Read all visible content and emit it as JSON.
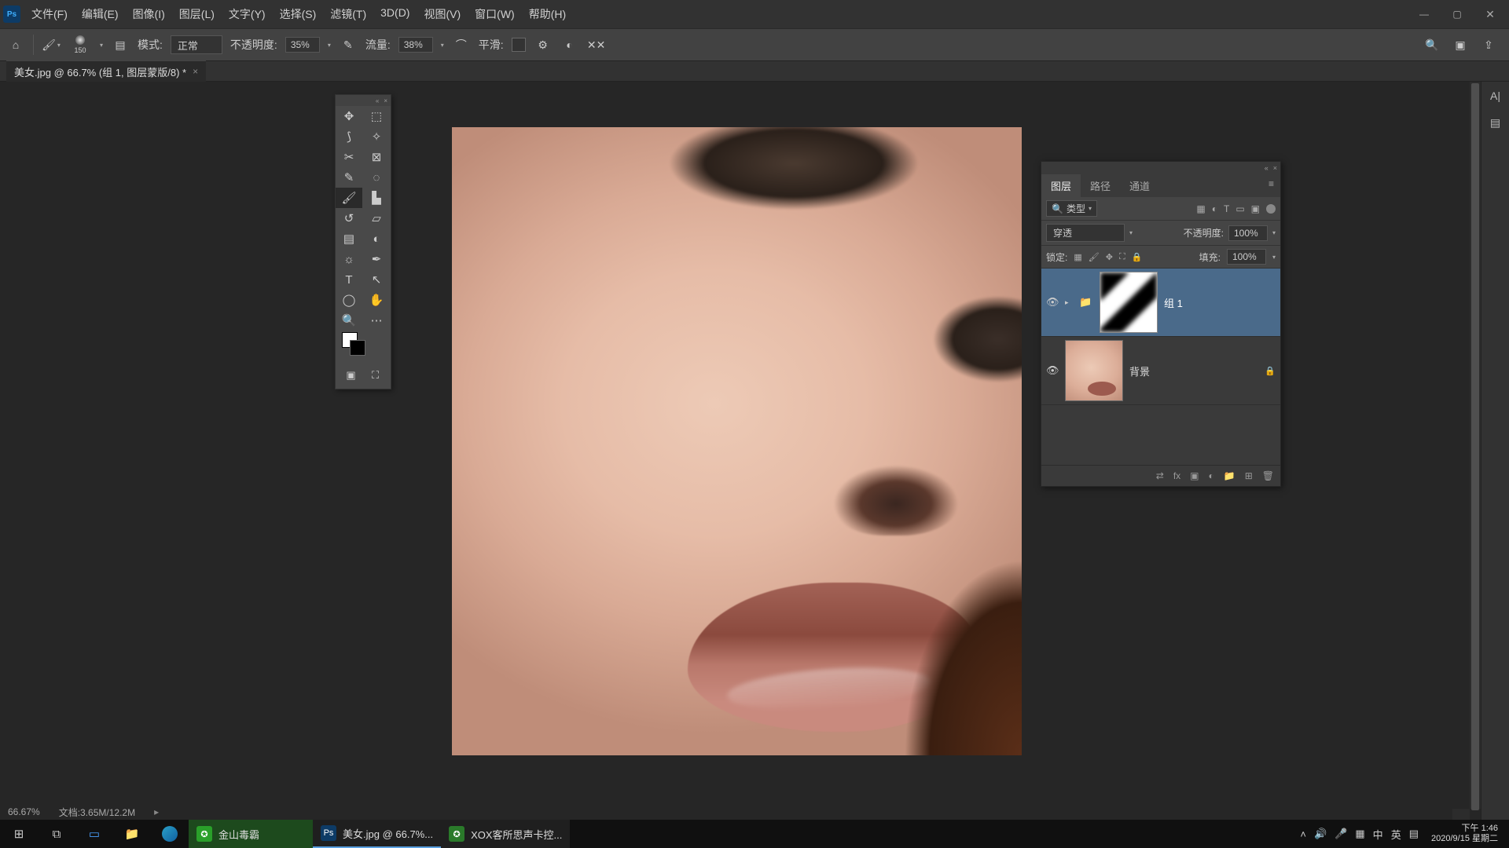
{
  "app": {
    "name": "Ps"
  },
  "menu": [
    "文件(F)",
    "编辑(E)",
    "图像(I)",
    "图层(L)",
    "文字(Y)",
    "选择(S)",
    "滤镜(T)",
    "3D(D)",
    "视图(V)",
    "窗口(W)",
    "帮助(H)"
  ],
  "window_controls": {
    "min": "—",
    "max": "▢",
    "close": "✕"
  },
  "options": {
    "brush_size": "150",
    "mode_label": "模式:",
    "mode_value": "正常",
    "opacity_label": "不透明度:",
    "opacity_value": "35%",
    "flow_label": "流量:",
    "flow_value": "38%",
    "smooth_label": "平滑:"
  },
  "doc_tab": {
    "title": "美女.jpg @ 66.7% (组 1, 图层蒙版/8) *"
  },
  "status": {
    "zoom": "66.67%",
    "doc": "文档:3.65M/12.2M"
  },
  "tools": [
    {
      "name": "move-tool",
      "g": "✥"
    },
    {
      "name": "marquee-tool",
      "g": "⬚"
    },
    {
      "name": "lasso-tool",
      "g": "⟆"
    },
    {
      "name": "quick-select-tool",
      "g": "✧"
    },
    {
      "name": "crop-tool",
      "g": "✂"
    },
    {
      "name": "frame-tool",
      "g": "⊠"
    },
    {
      "name": "eyedropper-tool",
      "g": "✎"
    },
    {
      "name": "spot-heal-tool",
      "g": "◌"
    },
    {
      "name": "brush-tool",
      "g": "🖌",
      "active": true
    },
    {
      "name": "stamp-tool",
      "g": "▙"
    },
    {
      "name": "history-brush-tool",
      "g": "↺"
    },
    {
      "name": "eraser-tool",
      "g": "▱"
    },
    {
      "name": "gradient-tool",
      "g": "▤"
    },
    {
      "name": "blur-tool",
      "g": "◐"
    },
    {
      "name": "dodge-tool",
      "g": "☼"
    },
    {
      "name": "pen-tool",
      "g": "✒"
    },
    {
      "name": "type-tool",
      "g": "T"
    },
    {
      "name": "path-select-tool",
      "g": "↖"
    },
    {
      "name": "shape-tool",
      "g": "◯"
    },
    {
      "name": "hand-tool",
      "g": "✋"
    },
    {
      "name": "zoom-tool",
      "g": "🔍"
    },
    {
      "name": "more-tool",
      "g": "⋯"
    }
  ],
  "layers_panel": {
    "tabs": [
      "图层",
      "路径",
      "通道"
    ],
    "filter_label_prefix": "🔍",
    "filter_label": "类型",
    "blend_mode": "穿透",
    "opacity_label": "不透明度:",
    "opacity_value": "100%",
    "lock_label": "锁定:",
    "fill_label": "填充:",
    "fill_value": "100%",
    "layers": [
      {
        "name": "组 1",
        "kind": "group-mask",
        "selected": true
      },
      {
        "name": "背景",
        "kind": "bg",
        "locked": true
      }
    ]
  },
  "taskbar": {
    "apps": [
      {
        "name": "金山毒霸",
        "bg": "#1d6b1d",
        "active": true,
        "wide": true,
        "icon_bg": "#2aa02a"
      },
      {
        "name": "美女.jpg @ 66.7%...",
        "bg": "#2a2a2a",
        "wide": true,
        "active": true,
        "icon_bg": "#0d3b66",
        "icon_text": "Ps"
      },
      {
        "name": "XOX客所思声卡控...",
        "bg": "#1f1f1f",
        "wide": true,
        "icon_bg": "#2a7a2a"
      }
    ],
    "clock_time": "下午 1:46",
    "clock_date": "2020/9/15 星期二"
  }
}
